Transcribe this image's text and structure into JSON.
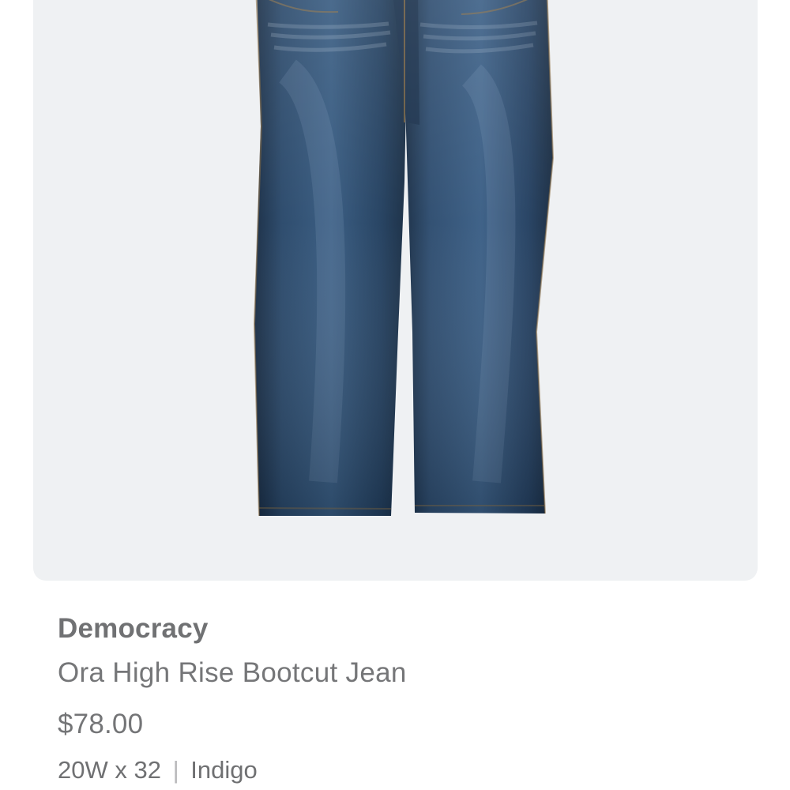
{
  "product": {
    "brand": "Democracy",
    "name": "Ora High Rise Bootcut Jean",
    "price": "$78.00",
    "size": "20W x 32",
    "separator": "|",
    "color": "Indigo",
    "image_icon": "bootcut-jeans-product-image"
  },
  "colors": {
    "card_background": "#eff1f3",
    "denim_main": "#243f5d",
    "denim_dark": "#172b42",
    "text": "#757678"
  }
}
